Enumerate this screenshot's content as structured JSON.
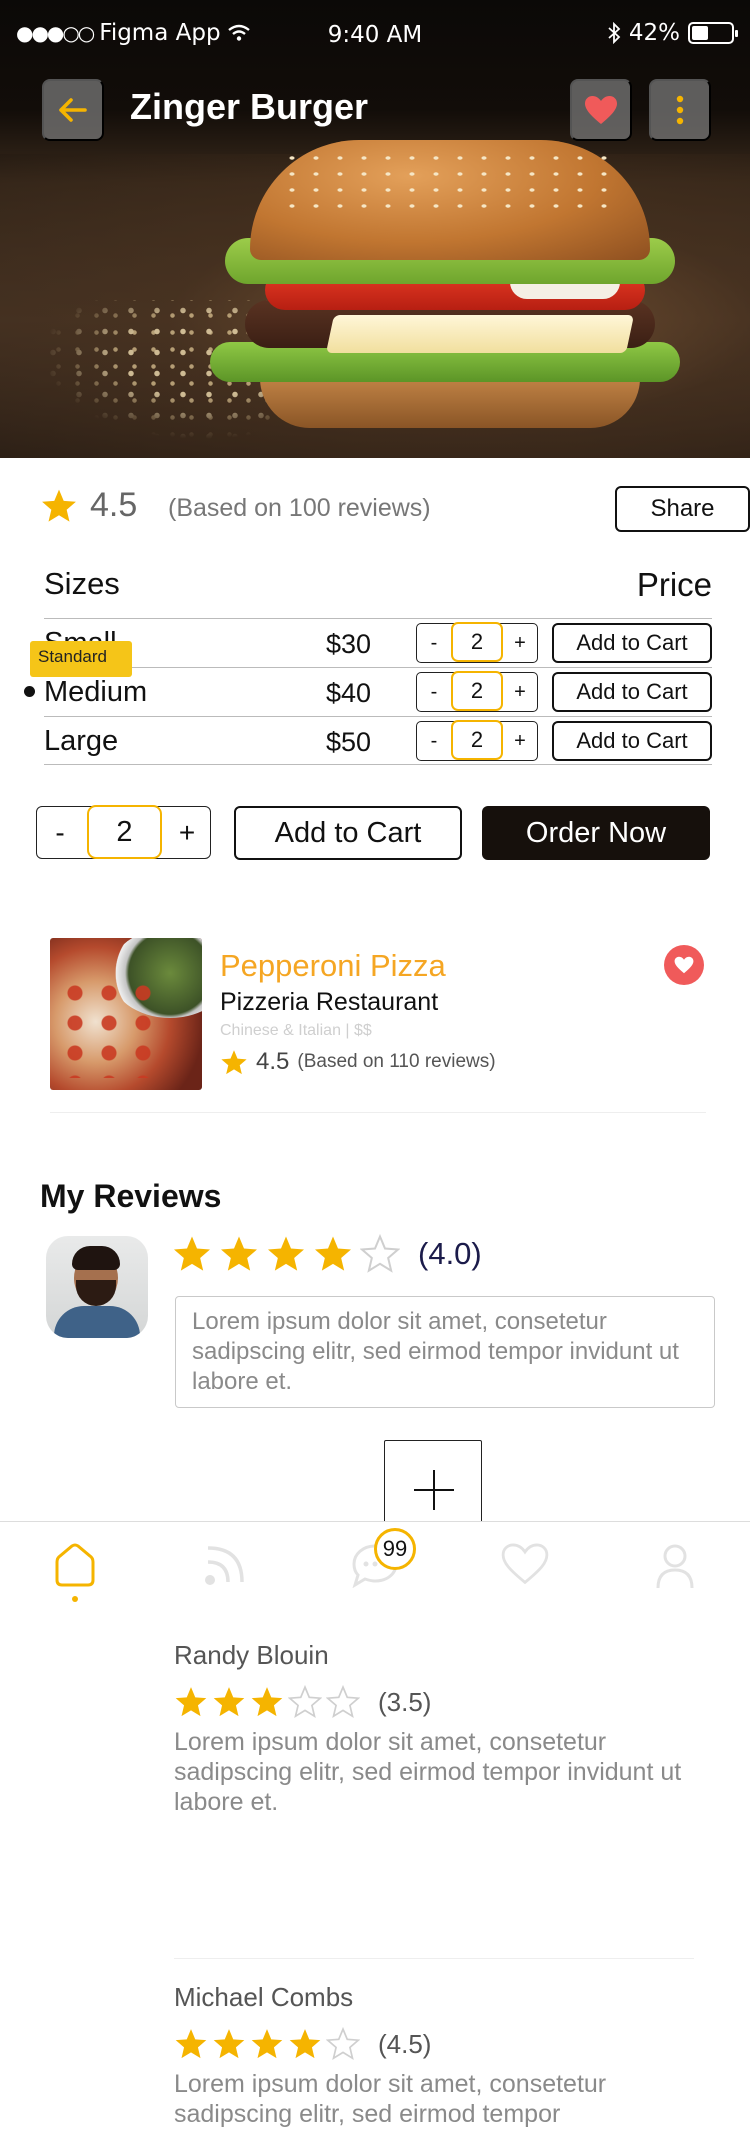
{
  "status_bar": {
    "signal": "●●●○○",
    "carrier": "Figma App",
    "time": "9:40 AM",
    "battery": "42%"
  },
  "header": {
    "title": "Zinger Burger"
  },
  "rating": {
    "value": "4.5",
    "reviews_label": "(Based on 100 reviews)",
    "share_label": "Share"
  },
  "sizes": {
    "heading": "Sizes",
    "price_heading": "Price",
    "selected_tag": "Standard",
    "rows": [
      {
        "name": "Small",
        "price": "$30",
        "qty": "2",
        "cart_label": "Add to Cart"
      },
      {
        "name": "Medium",
        "price": "$40",
        "qty": "2",
        "cart_label": "Add to Cart"
      },
      {
        "name": "Large",
        "price": "$50",
        "qty": "2",
        "cart_label": "Add to Cart"
      }
    ],
    "minus": "-",
    "plus": "+"
  },
  "order": {
    "minus": "-",
    "qty": "2",
    "plus": "+",
    "cart_label": "Add to Cart",
    "order_label": "Order Now"
  },
  "restaurant": {
    "dish": "Pepperoni Pizza",
    "name": "Pizzeria Restaurant",
    "cuisine": "Chinese & Italian | $$",
    "rating": "4.5",
    "reviews_label": "(Based on 110 reviews)"
  },
  "my_reviews": {
    "title": "My Reviews",
    "stars": 4,
    "score": "(4.0)",
    "text": "Lorem ipsum dolor sit amet, consetetur sadipscing elitr, sed eirmod tempor invidunt ut labore et."
  },
  "tabbar": {
    "chat_badge": "99"
  },
  "reviews": [
    {
      "name": "Randy Blouin",
      "stars": 3,
      "score": "(3.5)",
      "text": "Lorem ipsum dolor sit amet, consetetur sadipscing elitr, sed eirmod tempor invidunt ut labore et."
    },
    {
      "name": "Michael Combs",
      "stars": 4,
      "score": "(4.5)",
      "text": "Lorem ipsum dolor sit amet, consetetur sadipscing elitr, sed eirmod tempor"
    }
  ],
  "colors": {
    "accent": "#f5b400",
    "dark": "#16100c",
    "heart": "#f05a5a",
    "dish": "#f5a623"
  }
}
